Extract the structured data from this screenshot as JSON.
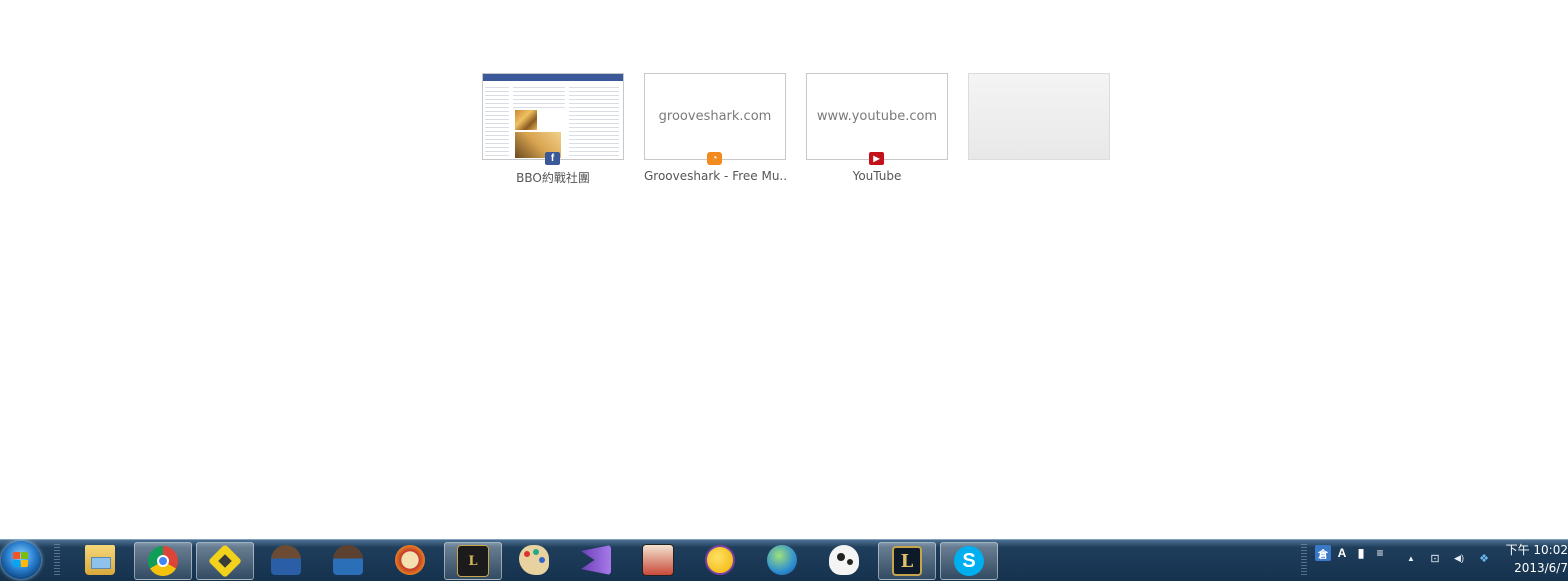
{
  "most_visited": [
    {
      "title": "BBO約戰社團",
      "domain": "",
      "favicon": "facebook-icon",
      "favicon_color": "#3b5998",
      "favicon_glyph": "f"
    },
    {
      "title": "Grooveshark - Free Mu...",
      "domain": "grooveshark.com",
      "favicon": "grooveshark-icon",
      "favicon_color": "#f28a1d",
      "favicon_glyph": "◔"
    },
    {
      "title": "YouTube",
      "domain": "www.youtube.com",
      "favicon": "youtube-icon",
      "favicon_color": "#c4121a",
      "favicon_glyph": "▶"
    },
    {
      "title": "",
      "domain": "",
      "favicon": "",
      "favicon_color": "",
      "favicon_glyph": ""
    }
  ],
  "taskbar": {
    "start_icon": "windows-start-icon",
    "pinned": [
      {
        "name": "explorer-icon",
        "active": false
      },
      {
        "name": "chrome-icon",
        "active": true
      },
      {
        "name": "yellow-app-icon",
        "active": true
      },
      {
        "name": "basketball-player-icon",
        "active": false
      },
      {
        "name": "basketball-player-2-icon",
        "active": false
      },
      {
        "name": "clock-game-icon",
        "active": false
      },
      {
        "name": "lol-launcher-icon",
        "active": true
      },
      {
        "name": "paint-palette-icon",
        "active": false
      },
      {
        "name": "visual-studio-icon",
        "active": false
      },
      {
        "name": "anime-game-icon",
        "active": false
      },
      {
        "name": "yahoo-messenger-icon",
        "active": false
      },
      {
        "name": "network-globe-icon",
        "active": false
      },
      {
        "name": "cow-icon",
        "active": false
      },
      {
        "name": "league-of-legends-icon",
        "active": true
      },
      {
        "name": "skype-icon",
        "active": true
      }
    ],
    "language_bar": [
      "倉",
      "A",
      "▮",
      "≡"
    ],
    "tray": [
      "▲",
      "⊡",
      "◀)",
      "❖"
    ]
  },
  "clock": {
    "time": "下午 10:02",
    "date": "2013/6/7"
  }
}
